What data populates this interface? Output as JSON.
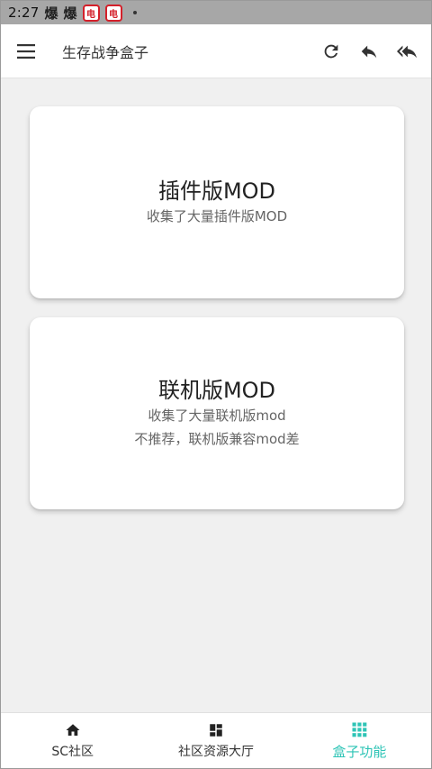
{
  "status_bar": {
    "time": "2:27",
    "notif_1": "爆",
    "notif_2": "爆",
    "badge_1": "电",
    "badge_2": "电"
  },
  "app_bar": {
    "title": "生存战争盒子",
    "icons": [
      "menu-icon",
      "refresh-icon",
      "reply-icon",
      "reply-all-icon"
    ]
  },
  "cards": [
    {
      "title": "插件版MOD",
      "lines": [
        "收集了大量插件版MOD"
      ]
    },
    {
      "title": "联机版MOD",
      "lines": [
        "收集了大量联机版mod",
        "不推荐，联机版兼容mod差"
      ]
    }
  ],
  "bottom_nav": {
    "items": [
      {
        "label": "SC社区",
        "icon": "home-icon",
        "active": false
      },
      {
        "label": "社区资源大厅",
        "icon": "dashboard-icon",
        "active": false
      },
      {
        "label": "盒子功能",
        "icon": "grid-icon",
        "active": true
      }
    ],
    "active_color": "#2ec4b6"
  }
}
